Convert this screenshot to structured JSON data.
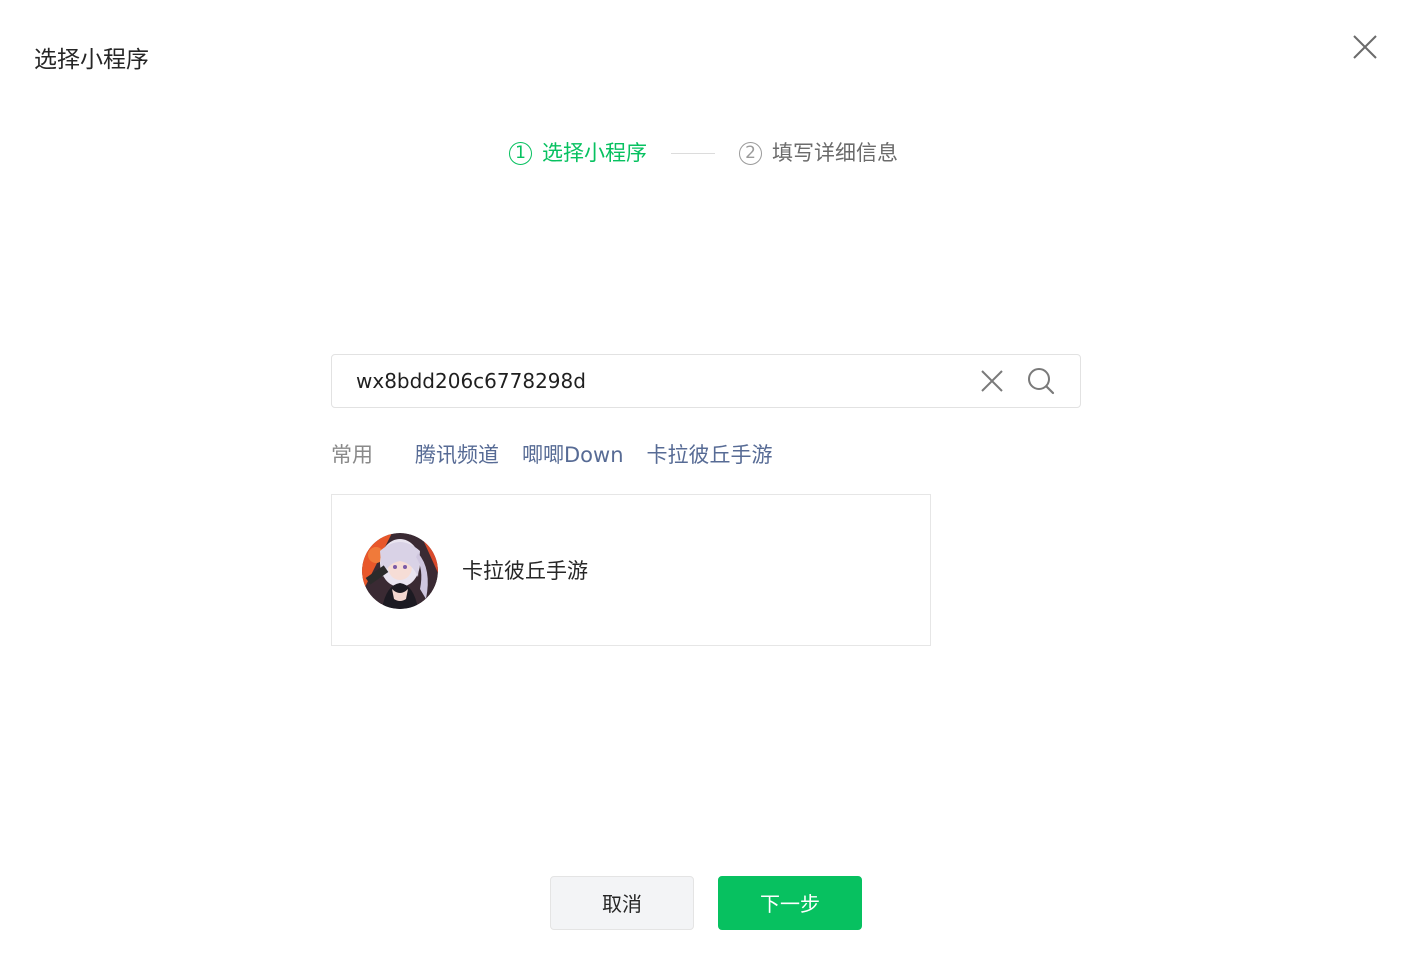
{
  "dialog": {
    "title": "选择小程序"
  },
  "steps": [
    {
      "number": "1",
      "label": "选择小程序",
      "active": true
    },
    {
      "number": "2",
      "label": "填写详细信息",
      "active": false
    }
  ],
  "search": {
    "value": "wx8bdd206c6778298d",
    "placeholder": ""
  },
  "frequent": {
    "label": "常用",
    "items": [
      "腾讯频道",
      "唧唧Down",
      "卡拉彼丘手游"
    ]
  },
  "result": {
    "name": "卡拉彼丘手游",
    "avatar_icon": "character-avatar"
  },
  "buttons": {
    "cancel_label": "取消",
    "next_label": "下一步"
  },
  "colors": {
    "accent": "#07c160",
    "link": "#576b95",
    "muted": "#9b9b9b"
  }
}
